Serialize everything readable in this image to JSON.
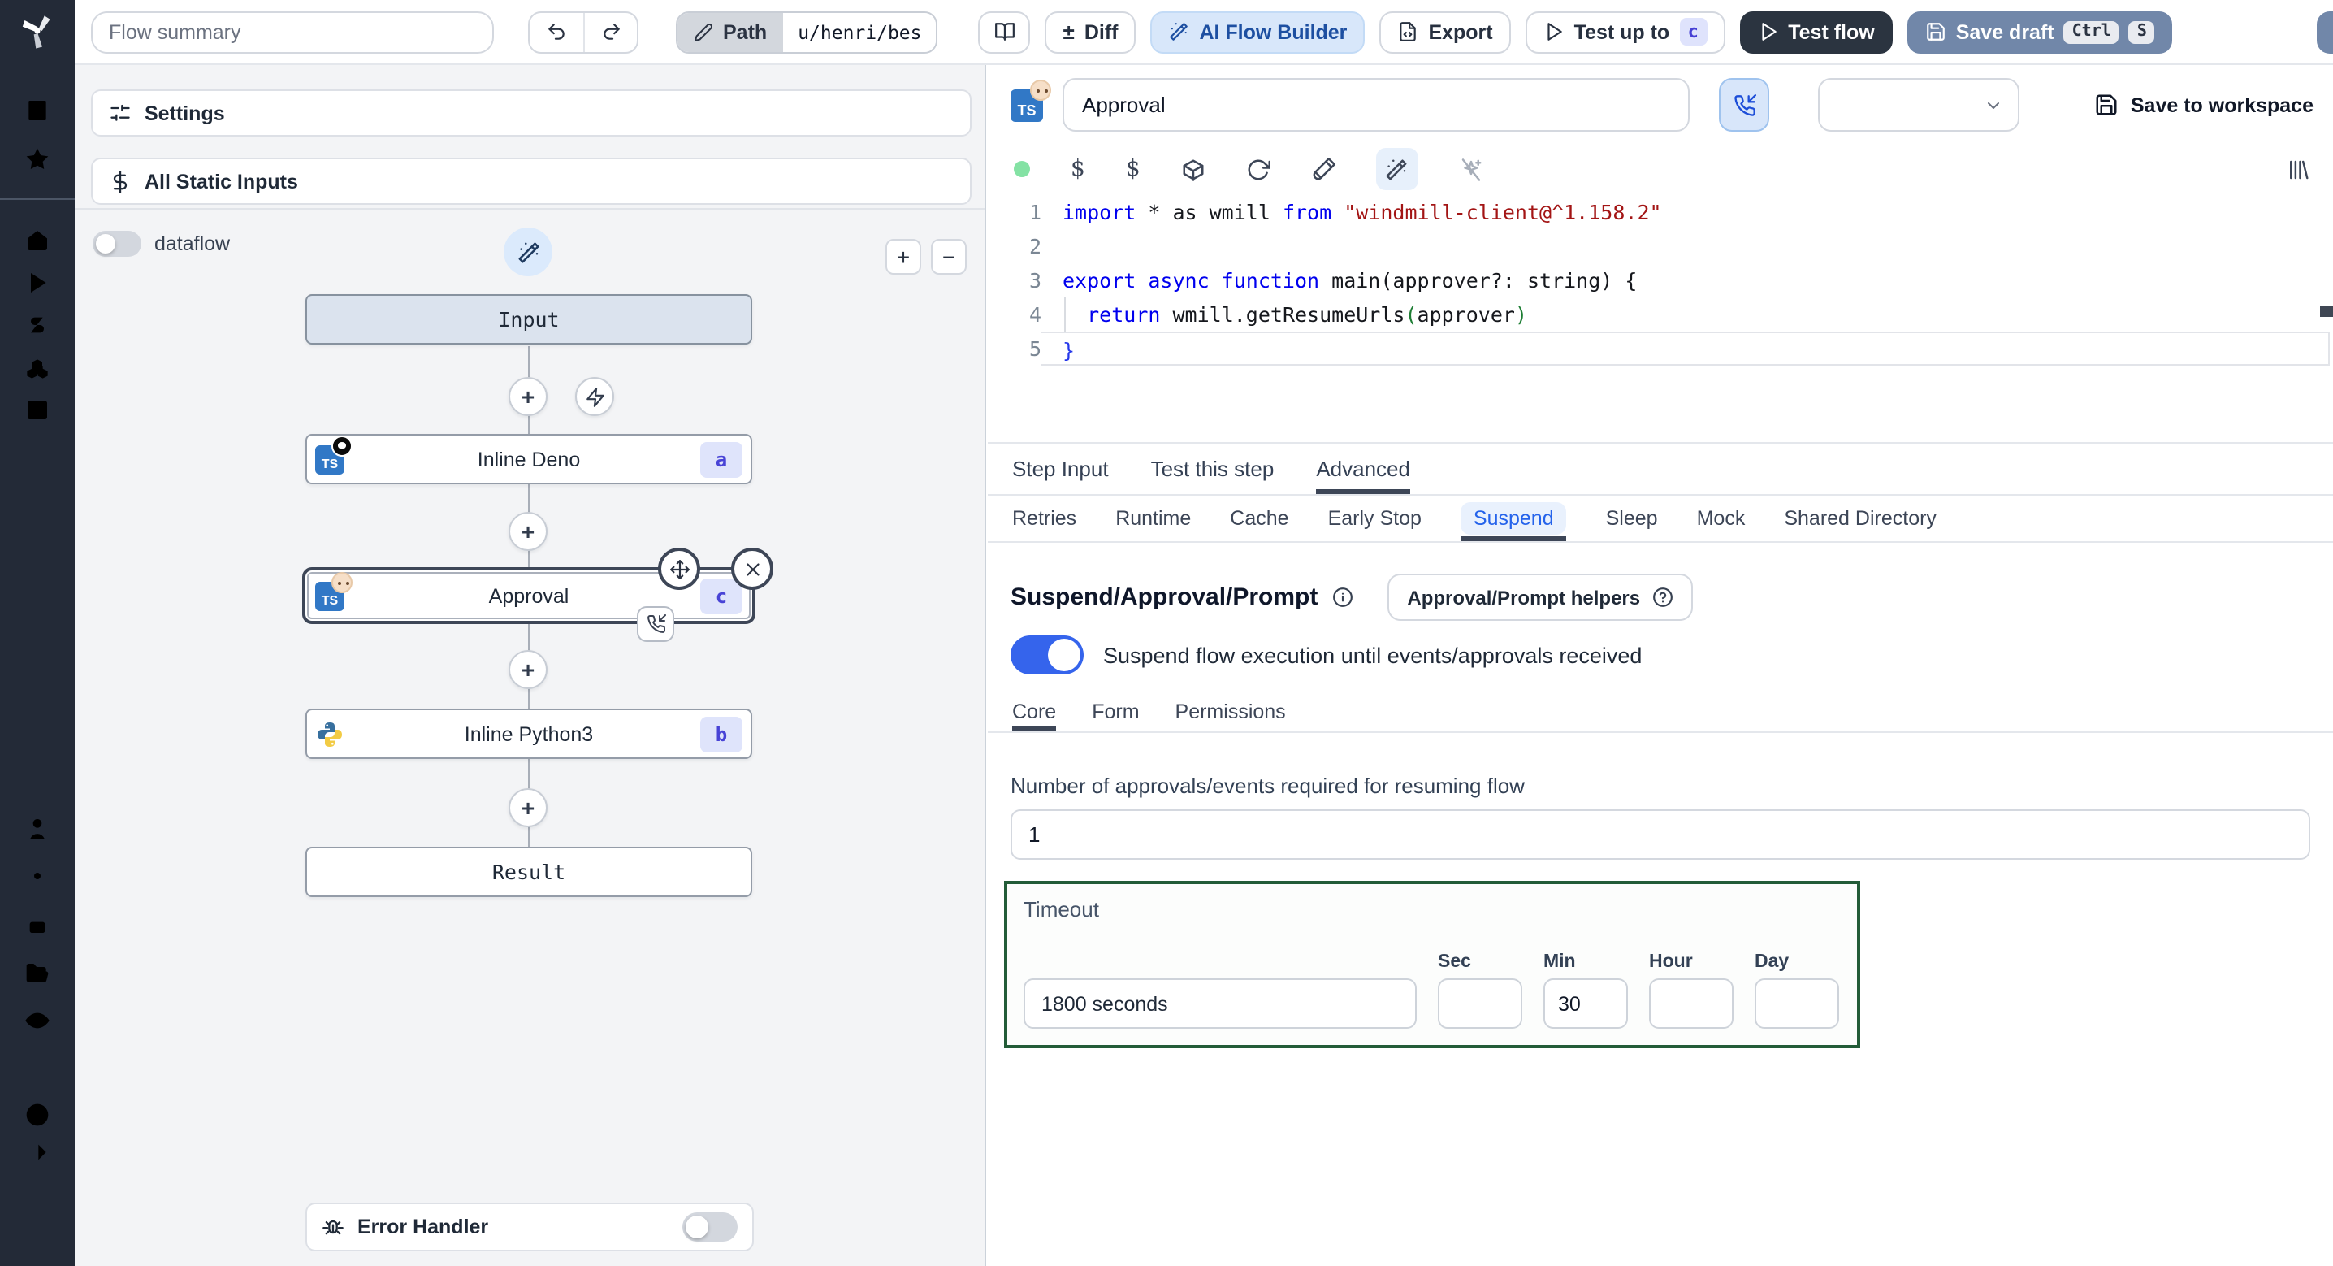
{
  "colors": {
    "accent_blue": "#3564ec",
    "ai_button_bg": "#d8e7fa",
    "save_draft_bg": "#7187a9",
    "dark_button_bg": "#2b3440",
    "badge_bg": "#dfe4fb",
    "badge_text": "#4843d6",
    "timeout_border": "#235c38",
    "status_dot": "#84e2a4",
    "sidebar_bg": "#232a37"
  },
  "topbar": {
    "flow_summary_placeholder": "Flow summary",
    "path_label": "Path",
    "path_value": "u/henri/bes",
    "diff_label": "Diff",
    "diff_sign": "±",
    "ai_flow_builder_label": "AI Flow Builder",
    "export_label": "Export",
    "test_up_to_label": "Test up to",
    "test_up_to_badge": "c",
    "test_flow_label": "Test flow",
    "save_draft_label": "Save draft",
    "kbd_ctrl": "Ctrl",
    "kbd_s": "S"
  },
  "sidebar": {
    "icons": [
      "windmill-logo",
      "workspace-building",
      "favorites-star",
      "home",
      "runs-play",
      "variables-dollar",
      "resources-boxes",
      "schedules-calendar",
      "user",
      "settings-gear",
      "workers-robot",
      "folders",
      "audit-eye",
      "help-question",
      "collapse-arrow-right"
    ]
  },
  "flow": {
    "settings_label": "Settings",
    "static_inputs_label": "All Static Inputs",
    "dataflow_label": "dataflow",
    "zoom_in": "+",
    "zoom_out": "−",
    "ts_label": "TS",
    "nodes": {
      "input_label": "Input",
      "deno": {
        "label": "Inline Deno",
        "badge": "a"
      },
      "approval": {
        "label": "Approval",
        "badge": "c"
      },
      "python": {
        "label": "Inline Python3",
        "badge": "b"
      },
      "result_label": "Result"
    },
    "error_handler_label": "Error Handler"
  },
  "editor": {
    "lines": [
      {
        "no": "1",
        "segs": [
          {
            "t": "import"
          },
          {
            "t": " * as wmill "
          },
          {
            "t": "from"
          },
          {
            "t": " \"windmill-client@^1.158.2\""
          }
        ]
      },
      {
        "no": "2",
        "segs": []
      },
      {
        "no": "3",
        "segs": [
          {
            "t": "export async function"
          },
          {
            "t": " main(approver?: string) {"
          }
        ]
      },
      {
        "no": "4",
        "segs": [
          {
            "t": "  "
          },
          {
            "t": "return"
          },
          {
            "t": " wmill.getResumeUrls"
          },
          {
            "t": "("
          },
          {
            "t": "approver"
          },
          {
            "t": ")"
          }
        ]
      },
      {
        "no": "5",
        "segs": [
          {
            "t": "}"
          }
        ]
      }
    ]
  },
  "step": {
    "ts_label": "TS",
    "name_value": "Approval",
    "save_to_workspace_label": "Save to workspace",
    "tabs": [
      {
        "label": "Step Input"
      },
      {
        "label": "Test this step"
      },
      {
        "label": "Advanced"
      }
    ],
    "active_tab": "Advanced",
    "subtabs": [
      {
        "label": "Retries"
      },
      {
        "label": "Runtime"
      },
      {
        "label": "Cache"
      },
      {
        "label": "Early Stop"
      },
      {
        "label": "Suspend"
      },
      {
        "label": "Sleep"
      },
      {
        "label": "Mock"
      },
      {
        "label": "Shared Directory"
      }
    ],
    "active_subtab": "Suspend",
    "suspend": {
      "title": "Suspend/Approval/Prompt",
      "helpers_button_label": "Approval/Prompt helpers",
      "toggle_label": "Suspend flow execution until events/approvals received",
      "toggle_on": true,
      "tabs": [
        {
          "label": "Core"
        },
        {
          "label": "Form"
        },
        {
          "label": "Permissions"
        }
      ],
      "active": "Core",
      "approvals_label": "Number of approvals/events required for resuming flow",
      "approvals_value": "1",
      "timeout": {
        "label": "Timeout",
        "display_value": "1800 seconds",
        "units": [
          {
            "label": "Sec",
            "value": ""
          },
          {
            "label": "Min",
            "value": "30"
          },
          {
            "label": "Hour",
            "value": ""
          },
          {
            "label": "Day",
            "value": ""
          }
        ]
      }
    }
  }
}
